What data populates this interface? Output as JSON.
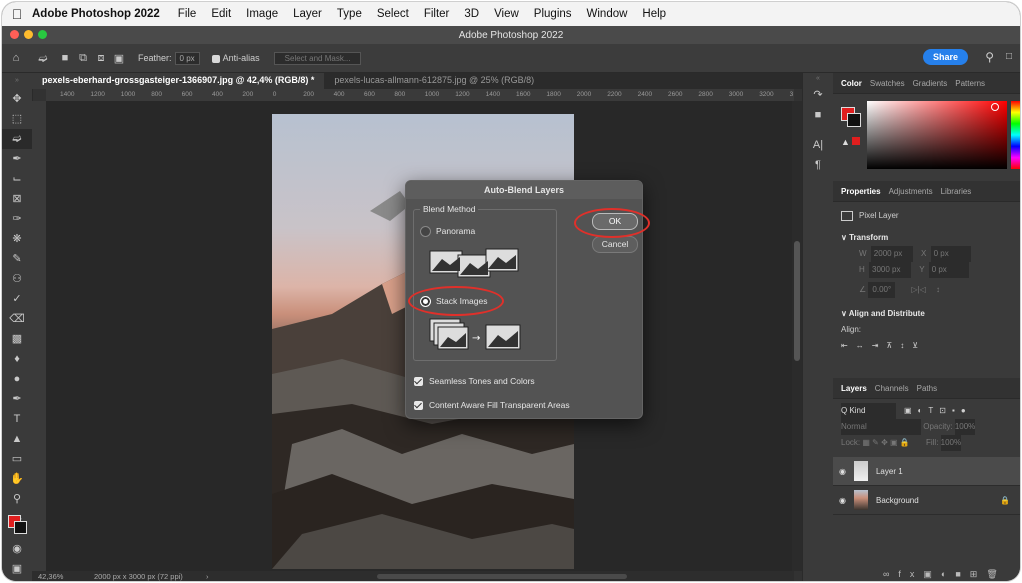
{
  "menubar": {
    "app_name": "Adobe Photoshop 2022",
    "items": [
      "File",
      "Edit",
      "Image",
      "Layer",
      "Type",
      "Select",
      "Filter",
      "3D",
      "View",
      "Plugins",
      "Window",
      "Help"
    ]
  },
  "window": {
    "title": "Adobe Photoshop 2022"
  },
  "options_bar": {
    "feather_label": "Feather:",
    "feather_value": "0 px",
    "anti_alias_label": "Anti-alias",
    "select_mask_label": "Select and Mask...",
    "share_label": "Share"
  },
  "tabs": [
    {
      "label": "pexels-eberhard-grossgasteiger-1366907.jpg @ 42,4% (RGB/8) *"
    },
    {
      "label": "pexels-lucas-allmann-612875.jpg @ 25% (RGB/8)"
    }
  ],
  "ruler_ticks": [
    "1400",
    "1200",
    "1000",
    "800",
    "600",
    "400",
    "200",
    "0",
    "200",
    "400",
    "600",
    "800",
    "1000",
    "1200",
    "1400",
    "1600",
    "1800",
    "2000",
    "2200",
    "2400",
    "2600",
    "2800",
    "3000",
    "3200",
    "3"
  ],
  "status": {
    "zoom": "42,36%",
    "doc_size": "2000 px x 3000 px (72 ppi)"
  },
  "color_panel": {
    "tabs": [
      "Color",
      "Swatches",
      "Gradients",
      "Patterns"
    ]
  },
  "properties_panel": {
    "tabs": [
      "Properties",
      "Adjustments",
      "Libraries"
    ],
    "layer_type": "Pixel Layer",
    "transform_label": "Transform",
    "w_label": "W",
    "w_value": "2000 px",
    "x_label": "X",
    "x_value": "0 px",
    "h_label": "H",
    "h_value": "3000 px",
    "y_label": "Y",
    "y_value": "0 px",
    "angle_value": "0.00°",
    "align_label": "Align and Distribute",
    "align_sub": "Align:"
  },
  "layers_panel": {
    "tabs": [
      "Layers",
      "Channels",
      "Paths"
    ],
    "kind_label": "Q Kind",
    "blend_mode": "Normal",
    "opacity_label": "Opacity:",
    "opacity_value": "100%",
    "lock_label": "Lock:",
    "fill_label": "Fill:",
    "fill_value": "100%",
    "layers": [
      {
        "name": "Layer 1"
      },
      {
        "name": "Background"
      }
    ]
  },
  "dialog": {
    "title": "Auto-Blend Layers",
    "blend_method_label": "Blend Method",
    "panorama_label": "Panorama",
    "stack_images_label": "Stack Images",
    "selected_method": "Stack Images",
    "ok_label": "OK",
    "cancel_label": "Cancel",
    "seamless_label": "Seamless Tones and Colors",
    "seamless_checked": true,
    "content_aware_label": "Content Aware Fill Transparent Areas",
    "content_aware_checked": true
  },
  "colors": {
    "foreground": "#e01e1e",
    "background": "#111111",
    "accent": "#2680eb",
    "highlight_ring": "#e0302a"
  }
}
